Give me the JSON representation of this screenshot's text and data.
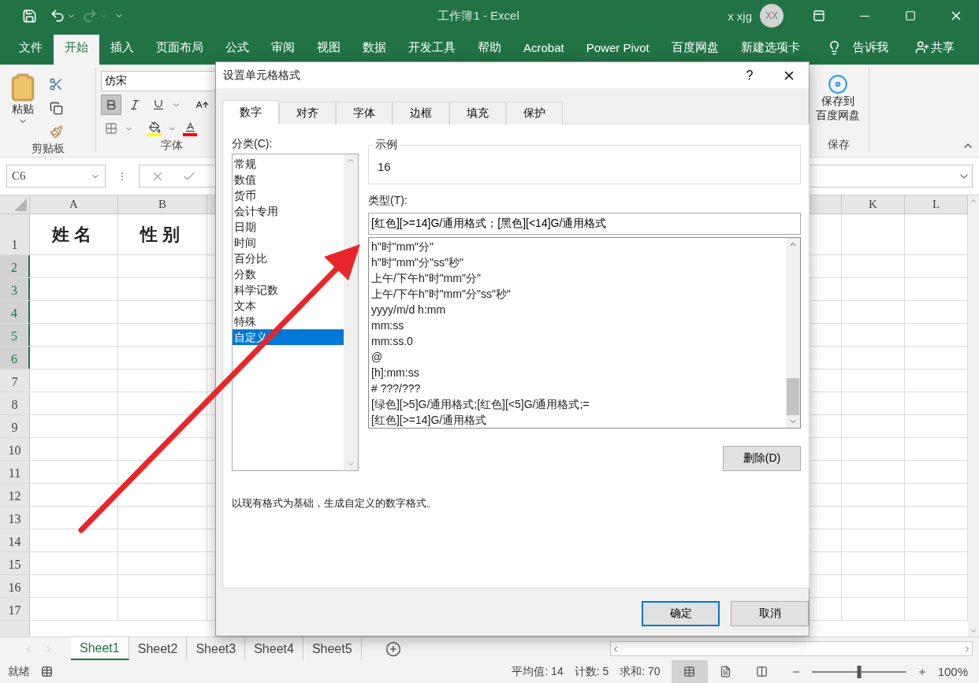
{
  "window": {
    "title": "工作簿1 - Excel",
    "user": "x xjg",
    "avatar": "XX"
  },
  "ribbon_tabs": [
    {
      "label": "文件",
      "selected": false
    },
    {
      "label": "开始",
      "selected": true
    },
    {
      "label": "插入",
      "selected": false
    },
    {
      "label": "页面布局",
      "selected": false
    },
    {
      "label": "公式",
      "selected": false
    },
    {
      "label": "审阅",
      "selected": false
    },
    {
      "label": "视图",
      "selected": false
    },
    {
      "label": "数据",
      "selected": false
    },
    {
      "label": "开发工具",
      "selected": false
    },
    {
      "label": "帮助",
      "selected": false
    },
    {
      "label": "Acrobat",
      "selected": false
    },
    {
      "label": "Power Pivot",
      "selected": false
    },
    {
      "label": "百度网盘",
      "selected": false
    },
    {
      "label": "新建选项卡",
      "selected": false
    }
  ],
  "tell_me": "告诉我",
  "share": "共享",
  "ribbon": {
    "clipboard": {
      "paste": "粘贴",
      "group": "剪贴板"
    },
    "font": {
      "name": "仿宋",
      "bold": true,
      "group": "字体"
    },
    "save": {
      "lines": [
        "保存到",
        "百度网盘"
      ],
      "group": "保存"
    }
  },
  "formula_bar": {
    "name_box": "C6"
  },
  "sheet": {
    "columns": [
      {
        "label": "A"
      },
      {
        "label": "B"
      },
      {
        "label": "K"
      },
      {
        "label": "L"
      }
    ],
    "rows": [
      {
        "label": "1",
        "selected": false,
        "cells": [
          "姓名",
          "性别"
        ]
      },
      {
        "label": "2",
        "selected": true
      },
      {
        "label": "3",
        "selected": true
      },
      {
        "label": "4",
        "selected": true
      },
      {
        "label": "5",
        "selected": true
      },
      {
        "label": "6",
        "selected": true
      },
      {
        "label": "7",
        "selected": false
      },
      {
        "label": "8",
        "selected": false
      },
      {
        "label": "9",
        "selected": false
      },
      {
        "label": "10",
        "selected": false
      },
      {
        "label": "11",
        "selected": false
      },
      {
        "label": "12",
        "selected": false
      },
      {
        "label": "13",
        "selected": false
      },
      {
        "label": "14",
        "selected": false
      },
      {
        "label": "15",
        "selected": false
      },
      {
        "label": "16",
        "selected": false
      },
      {
        "label": "17",
        "selected": false
      }
    ]
  },
  "sheet_tabs": [
    {
      "label": "Sheet1",
      "selected": true
    },
    {
      "label": "Sheet2",
      "selected": false
    },
    {
      "label": "Sheet3",
      "selected": false
    },
    {
      "label": "Sheet4",
      "selected": false
    },
    {
      "label": "Sheet5",
      "selected": false
    }
  ],
  "status_bar": {
    "ready": "就绪",
    "average": "平均值: 14",
    "count": "计数: 5",
    "sum": "求和: 70",
    "views": [
      {
        "kind": "normal",
        "selected": true
      },
      {
        "kind": "page_layout",
        "selected": false
      },
      {
        "kind": "page_break",
        "selected": false
      }
    ],
    "zoom_slider": {
      "level": 0.5
    },
    "zoom": "100%"
  },
  "dialog": {
    "title": "设置单元格格式",
    "help": "?",
    "tabs": [
      {
        "label": "数字",
        "selected": true
      },
      {
        "label": "对齐",
        "selected": false
      },
      {
        "label": "字体",
        "selected": false
      },
      {
        "label": "边框",
        "selected": false
      },
      {
        "label": "填充",
        "selected": false
      },
      {
        "label": "保护",
        "selected": false
      }
    ],
    "category_label": "分类(C):",
    "categories": [
      {
        "label": "常规",
        "selected": false
      },
      {
        "label": "数值",
        "selected": false
      },
      {
        "label": "货币",
        "selected": false
      },
      {
        "label": "会计专用",
        "selected": false
      },
      {
        "label": "日期",
        "selected": false
      },
      {
        "label": "时间",
        "selected": false
      },
      {
        "label": "百分比",
        "selected": false
      },
      {
        "label": "分数",
        "selected": false
      },
      {
        "label": "科学记数",
        "selected": false
      },
      {
        "label": "文本",
        "selected": false
      },
      {
        "label": "特殊",
        "selected": false
      },
      {
        "label": "自定义",
        "selected": true
      }
    ],
    "sample_label": "示例",
    "sample": "16",
    "type_label": "类型(T):",
    "type_value": "[红色][>=14]G/通用格式；[黑色][<14]G/通用格式",
    "formats": [
      "h\"时\"mm\"分\"",
      "h\"时\"mm\"分\"ss\"秒\"",
      "上午/下午h\"时\"mm\"分\"",
      "上午/下午h\"时\"mm\"分\"ss\"秒\"",
      "yyyy/m/d h:mm",
      "mm:ss",
      "mm:ss.0",
      "@",
      "[h]:mm:ss",
      "# ???/???",
      "[绿色][>5]G/通用格式;[红色][<5]G/通用格式;=",
      "[红色][>=14]G/通用格式"
    ],
    "delete": "删除(D)",
    "description": "以现有格式为基础，生成自定义的数字格式。",
    "ok": "确定",
    "cancel": "取消"
  }
}
